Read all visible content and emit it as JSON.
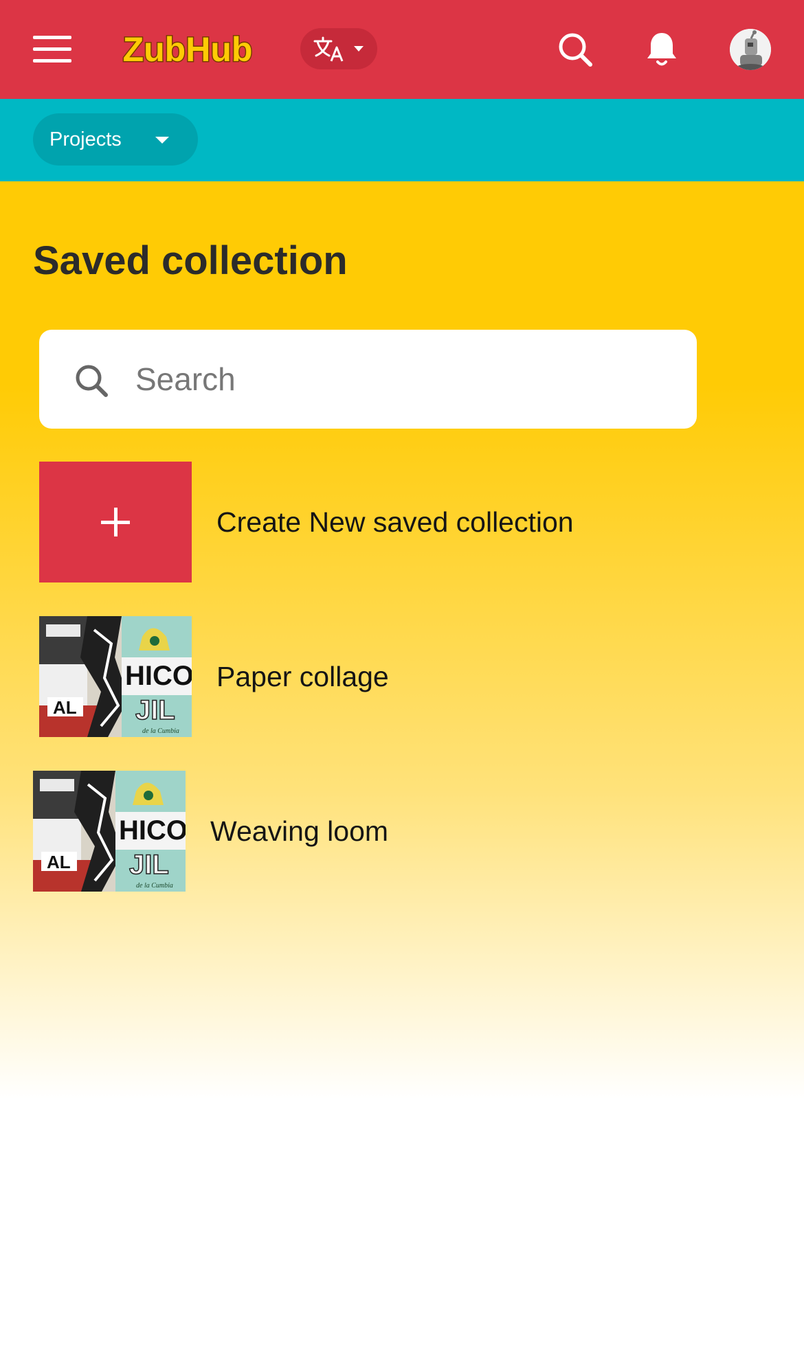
{
  "header": {
    "logo_text": "ZubHub",
    "menu_icon": "hamburger-menu-icon",
    "language_icon": "translate-icon",
    "search_icon": "search-icon",
    "notifications_icon": "bell-icon",
    "avatar_icon": "robot-avatar-icon",
    "brand_color": "#dc3545"
  },
  "subnav": {
    "projects_label": "Projects",
    "bar_color": "#00b8c4"
  },
  "page": {
    "title": "Saved collection"
  },
  "search": {
    "placeholder": "Search",
    "value": ""
  },
  "collections": {
    "create_label": "Create New saved collection",
    "items": [
      {
        "label": "Paper collage",
        "thumbnail": "torn-poster-collage-image"
      },
      {
        "label": "Weaving loom",
        "thumbnail": "torn-poster-collage-image"
      }
    ]
  },
  "colors": {
    "background_yellow": "#ffcb05",
    "accent_red": "#dc3545",
    "teal": "#00b8c4"
  }
}
